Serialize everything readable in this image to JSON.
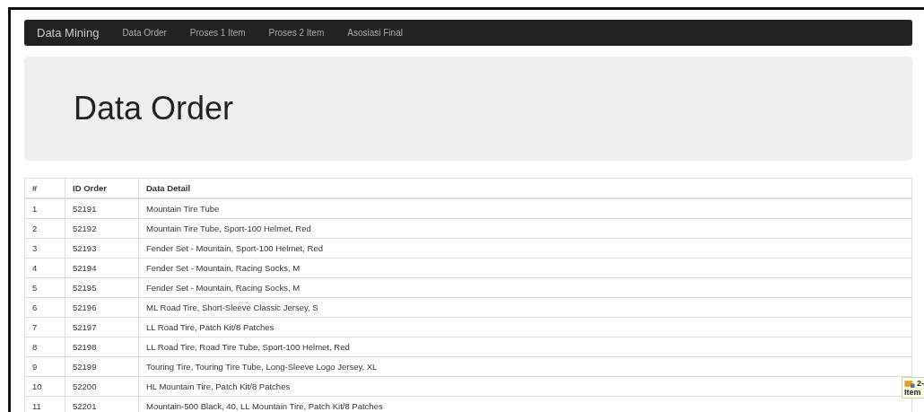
{
  "navbar": {
    "brand": "Data Mining",
    "links": [
      {
        "label": "Data Order"
      },
      {
        "label": "Proses 1 Item"
      },
      {
        "label": "Proses 2 Item"
      },
      {
        "label": "Asosiasi Final"
      }
    ]
  },
  "jumbotron": {
    "title": "Data Order"
  },
  "table": {
    "columns": [
      "#",
      "ID Order",
      "Data Detail"
    ],
    "rows": [
      [
        "1",
        "52191",
        "Mountain Tire Tube"
      ],
      [
        "2",
        "52192",
        "Mountain Tire Tube, Sport-100 Helmet, Red"
      ],
      [
        "3",
        "52193",
        "Fender Set - Mountain, Sport-100 Helmet, Red"
      ],
      [
        "4",
        "52194",
        "Fender Set - Mountain, Racing Socks, M"
      ],
      [
        "5",
        "52195",
        "Fender Set - Mountain, Racing Socks, M"
      ],
      [
        "6",
        "52196",
        "ML Road Tire, Short-Sleeve Classic Jersey, S"
      ],
      [
        "7",
        "52197",
        "LL Road Tire, Patch Kit/8 Patches"
      ],
      [
        "8",
        "52198",
        "LL Road Tire, Road Tire Tube, Sport-100 Helmet, Red"
      ],
      [
        "9",
        "52199",
        "Touring Tire, Touring Tire Tube, Long-Sleeve Logo Jersey, XL"
      ],
      [
        "10",
        "52200",
        "HL Mountain Tire, Patch Kit/8 Patches"
      ],
      [
        "11",
        "52201",
        "Mountain-500 Black, 40, LL Mountain Tire, Patch Kit/8 Patches"
      ]
    ]
  },
  "tooltip": {
    "lines": [
      "2-",
      "Item"
    ]
  }
}
